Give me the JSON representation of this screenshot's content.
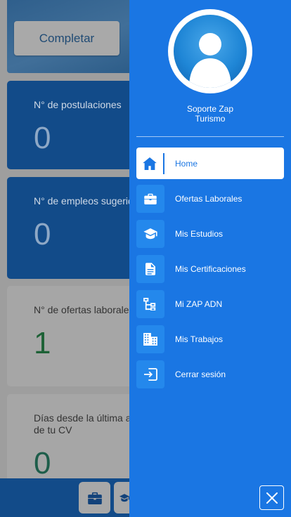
{
  "dashboard": {
    "complete_button": "Completar",
    "stats": [
      {
        "label": "N° de postulaciones",
        "value": "0"
      },
      {
        "label": "N° de empleos sugeridos",
        "value": "0"
      },
      {
        "label": "N° de ofertas laborales disponibles",
        "value": "1"
      },
      {
        "label": "Días desde la última act. de tu CV",
        "value": "0"
      }
    ]
  },
  "drawer": {
    "user_name_line1": "Soporte Zap",
    "user_name_line2": "Turismo",
    "menu": [
      {
        "label": "Home",
        "icon": "home-icon"
      },
      {
        "label": "Ofertas Laborales",
        "icon": "briefcase-icon"
      },
      {
        "label": "Mis Estudios",
        "icon": "graduation-cap-icon"
      },
      {
        "label": "Mis Certificaciones",
        "icon": "document-icon"
      },
      {
        "label": "Mi ZAP ADN",
        "icon": "sitemap-icon"
      },
      {
        "label": "Mis Trabajos",
        "icon": "building-icon"
      },
      {
        "label": "Cerrar sesión",
        "icon": "logout-icon"
      }
    ]
  },
  "colors": {
    "drawer_bg": "#1a76e3",
    "dashboard_blue": "#124b89",
    "value_green": "#1d6136"
  }
}
